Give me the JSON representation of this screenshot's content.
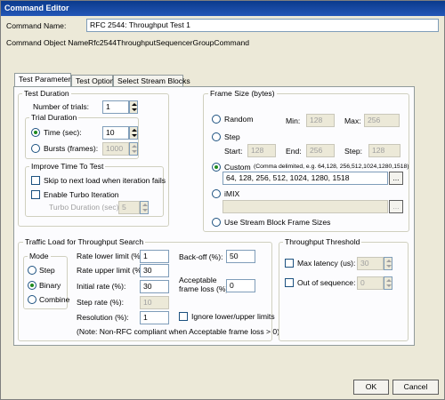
{
  "window": {
    "title": "Command Editor"
  },
  "command": {
    "name_label": "Command Name:",
    "name_value": "RFC 2544: Throughput Test 1",
    "object_label": "Command Object Name:",
    "object_value": "Rfc2544ThroughputSequencerGroupCommand"
  },
  "tabs": [
    "Test Parameters",
    "Test Options",
    "Select Stream Blocks"
  ],
  "test_duration": {
    "title": "Test Duration",
    "trials_label": "Number of trials:",
    "trials_value": "1",
    "trial_duration_title": "Trial Duration",
    "time_label": "Time (sec):",
    "time_value": "10",
    "bursts_label": "Bursts (frames):",
    "bursts_value": "1000"
  },
  "improve": {
    "title": "Improve Time To Test",
    "skip_label": "Skip to next load when iteration fails",
    "turbo_label": "Enable Turbo Iteration",
    "turbo_duration_label": "Turbo Duration (sec):",
    "turbo_duration_value": "5"
  },
  "frame_size": {
    "title": "Frame Size (bytes)",
    "random_label": "Random",
    "min_label": "Min:",
    "min_value": "128",
    "max_label": "Max:",
    "max_value": "256",
    "step_label": "Step",
    "start_label": "Start:",
    "start_value": "128",
    "end_label": "End:",
    "end_value": "256",
    "step_field_label": "Step:",
    "step_field_value": "128",
    "custom_label": "Custom",
    "custom_hint": "(Comma delimited, e.g. 64,128, 256,512,1024,1280,1518)",
    "custom_value": "64, 128, 256, 512, 1024, 1280, 1518",
    "browse_label": "...",
    "imix_label": "iMIX",
    "imix_browse_label": "...",
    "stream_label": "Use Stream Block Frame Sizes"
  },
  "traffic": {
    "title": "Traffic Load for Throughput Search",
    "mode_title": "Mode",
    "mode_step": "Step",
    "mode_binary": "Binary",
    "mode_combine": "Combine",
    "lower_label": "Rate lower limit (%):",
    "lower_value": "1",
    "upper_label": "Rate upper limit (%):",
    "upper_value": "30",
    "initial_label": "Initial rate (%):",
    "initial_value": "30",
    "step_rate_label": "Step rate (%):",
    "step_rate_value": "10",
    "resolution_label": "Resolution (%):",
    "resolution_value": "1",
    "backoff_label": "Back-off (%):",
    "backoff_value": "50",
    "acceptable_label_1": "Acceptable",
    "acceptable_label_2": "frame loss (%):",
    "acceptable_value": "0",
    "ignore_label": "Ignore lower/upper limits",
    "note": "(Note:  Non-RFC compliant when Acceptable frame loss > 0)"
  },
  "threshold": {
    "title": "Throughput Threshold",
    "latency_label": "Max latency (us):",
    "latency_value": "30",
    "sequence_label": "Out of sequence:",
    "sequence_value": "0"
  },
  "footer": {
    "ok_label": "OK",
    "cancel_label": "Cancel"
  }
}
